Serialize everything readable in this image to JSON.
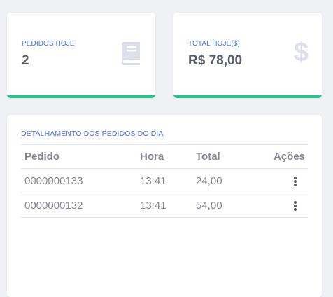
{
  "orders_card": {
    "label": "PEDIDOS HOJE",
    "value": "2",
    "icon": "book-icon"
  },
  "total_card": {
    "label": "TOTAL HOJE($)",
    "value": "R$ 78,00",
    "icon": "dollar-icon",
    "icon_glyph": "$"
  },
  "accent_color": "#1cc88a",
  "title_color": "#4e73df",
  "orders_table": {
    "title": "DETALHAMENTO DOS PEDIDOS DO DIA",
    "columns": [
      "Pedido",
      "Hora",
      "Total",
      "Ações"
    ],
    "rows": [
      {
        "pedido": "0000000133",
        "hora": "13:41",
        "total": "24,00"
      },
      {
        "pedido": "0000000132",
        "hora": "13:41",
        "total": "54,00"
      }
    ]
  }
}
